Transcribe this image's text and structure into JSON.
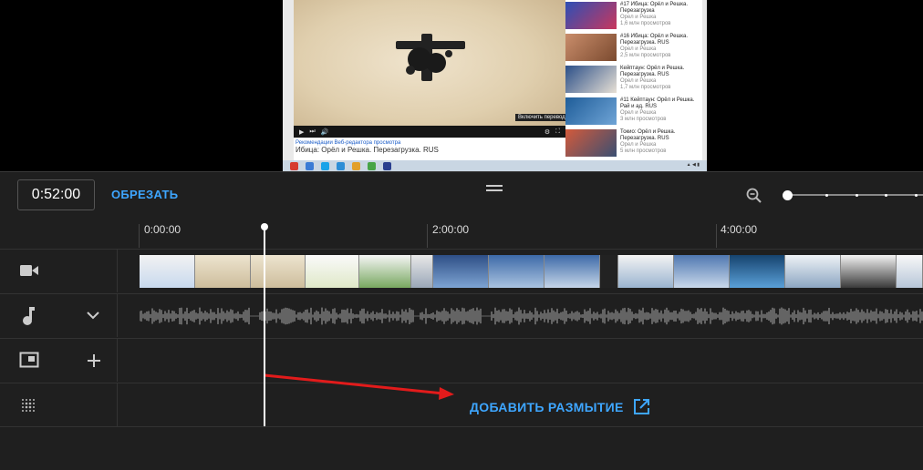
{
  "preview": {
    "tooltip": "Включить перевод (t)",
    "video_title_link": "Рекомендации Веб-редактора просмотра",
    "video_title": "Ибица: Орёл и Решка. Перезагрузка. RUS",
    "sidebar_items": [
      {
        "title": "#17 Ибица: Орёл и Решка. Перезагрузка",
        "channel": "Орел и Решка",
        "views": "1,6 млн просмотров"
      },
      {
        "title": "#16 Ибица: Орёл и Решка. Перезагрузка. RUS",
        "channel": "Орел и Решка",
        "views": "2,5 млн просмотров"
      },
      {
        "title": "Кейптаун: Орёл и Решка. Перезагрузка. RUS",
        "channel": "Орел и Решка",
        "views": "1,7 млн просмотров"
      },
      {
        "title": "#11 Кейптаун: Орёл и Решка. Рай и ад. RUS",
        "channel": "Орел и Решка",
        "views": "3 млн просмотров"
      },
      {
        "title": "Токио: Орёл и Решка. Перезагрузка. RUS",
        "channel": "Орел и Решка",
        "views": "5 млн просмотров"
      }
    ]
  },
  "editor": {
    "current_time": "0:52:00",
    "trim_label": "ОБРЕЗАТЬ",
    "playhead_fraction": 0.1446,
    "zoom_level_fraction": 0.0
  },
  "ruler": {
    "labels": [
      "0:00:00",
      "2:00:00",
      "4:00:00"
    ]
  },
  "tracks": [
    {
      "name": "video",
      "icon": "videocam-icon"
    },
    {
      "name": "audio",
      "icon": "music-note-icon",
      "extra_icon": "chevron-down-icon"
    },
    {
      "name": "overlay",
      "icon": "picture-in-picture-icon",
      "extra_icon": "plus-icon"
    },
    {
      "name": "blur",
      "icon": "blur-dots-icon"
    }
  ],
  "blur": {
    "label": "ДОБАВИТЬ РАЗМЫТИЕ",
    "icon": "open-in-new-icon"
  },
  "colors": {
    "accent": "#3ea6ff",
    "arrow": "#e21b1b",
    "background": "#1f1f1f"
  }
}
